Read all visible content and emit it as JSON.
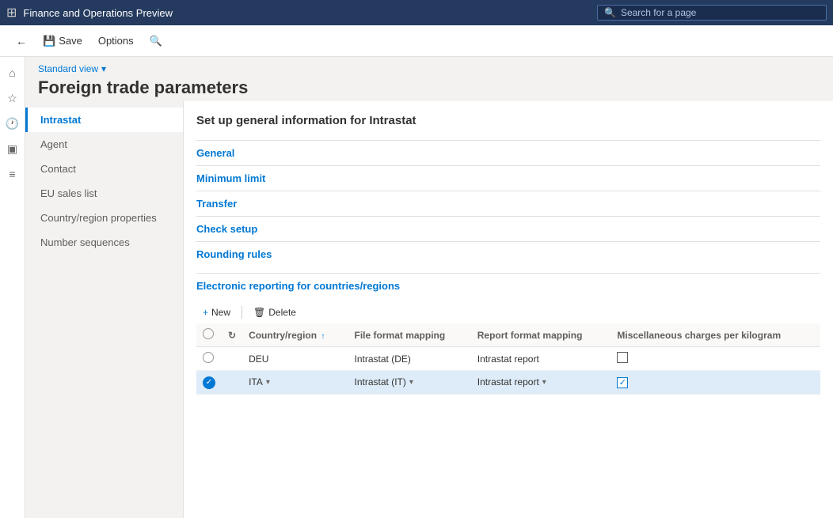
{
  "app": {
    "title": "Finance and Operations Preview",
    "search_placeholder": "Search for a page"
  },
  "toolbar": {
    "back_label": "Back",
    "save_label": "Save",
    "options_label": "Options",
    "search_label": "Search"
  },
  "breadcrumb": {
    "view_label": "Standard view",
    "chevron": "▾"
  },
  "page": {
    "title": "Foreign trade parameters"
  },
  "left_nav": {
    "items": [
      {
        "id": "intrastat",
        "label": "Intrastat",
        "active": true
      },
      {
        "id": "agent",
        "label": "Agent",
        "active": false
      },
      {
        "id": "contact",
        "label": "Contact",
        "active": false
      },
      {
        "id": "eu-sales",
        "label": "EU sales list",
        "active": false
      },
      {
        "id": "country-region",
        "label": "Country/region properties",
        "active": false
      },
      {
        "id": "number-sequences",
        "label": "Number sequences",
        "active": false
      }
    ]
  },
  "panel": {
    "subtitle": "Set up general information for Intrastat",
    "sections": [
      {
        "id": "general",
        "label": "General"
      },
      {
        "id": "minimum-limit",
        "label": "Minimum limit"
      },
      {
        "id": "transfer",
        "label": "Transfer"
      },
      {
        "id": "check-setup",
        "label": "Check setup"
      },
      {
        "id": "rounding-rules",
        "label": "Rounding rules"
      }
    ],
    "reporting_section": {
      "title": "Electronic reporting for countries/regions"
    }
  },
  "table_toolbar": {
    "new_label": "New",
    "delete_label": "Delete"
  },
  "table": {
    "columns": [
      {
        "id": "select",
        "label": ""
      },
      {
        "id": "refresh",
        "label": ""
      },
      {
        "id": "country_region",
        "label": "Country/region",
        "sortable": true
      },
      {
        "id": "file_format",
        "label": "File format mapping"
      },
      {
        "id": "report_format",
        "label": "Report format mapping"
      },
      {
        "id": "misc_charges",
        "label": "Miscellaneous charges per kilogram"
      }
    ],
    "rows": [
      {
        "id": "row-deu",
        "selected": false,
        "country": "DEU",
        "file_format": "Intrastat (DE)",
        "report_format": "Intrastat report",
        "misc_checked": false
      },
      {
        "id": "row-ita",
        "selected": true,
        "country": "ITA",
        "file_format": "Intrastat (IT)",
        "report_format": "Intrastat report",
        "misc_checked": true
      }
    ]
  },
  "icons": {
    "grid": "⊞",
    "search": "🔍",
    "back": "←",
    "save": "💾",
    "home": "⌂",
    "star": "☆",
    "clock": "🕐",
    "database": "▣",
    "list": "≡",
    "refresh": "↻",
    "plus": "+",
    "delete": "🗑",
    "chevron_down": "▾",
    "sort_up": "↑",
    "checkmark": "✓"
  }
}
